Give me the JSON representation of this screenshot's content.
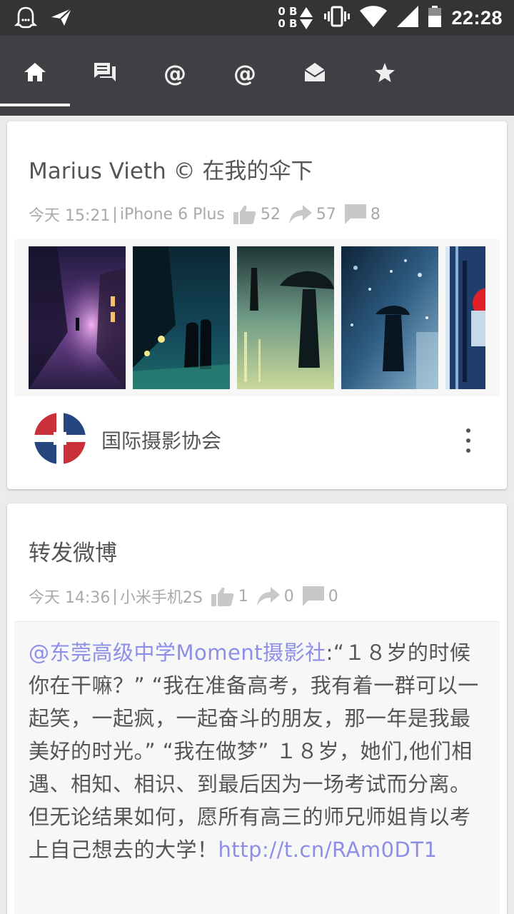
{
  "status_bar": {
    "time": "22:28",
    "net_up": "0 B",
    "net_down": "0 B",
    "icons": [
      "ghost-notification-icon",
      "send-icon",
      "vibrate-icon",
      "wifi-icon",
      "signal-icon",
      "battery-icon"
    ]
  },
  "tabs": [
    {
      "name": "home",
      "icon": "home-icon",
      "active": true
    },
    {
      "name": "comments",
      "icon": "comments-icon"
    },
    {
      "name": "mentions",
      "label": "@"
    },
    {
      "name": "mentions-2",
      "label": "@"
    },
    {
      "name": "messages",
      "icon": "envelope-open-icon"
    },
    {
      "name": "favorites",
      "icon": "star-icon"
    }
  ],
  "posts": [
    {
      "title": "Marius Vieth © 在我的伞下",
      "time": "今天 15:21",
      "separator": "|",
      "device": "iPhone 6 Plus",
      "likes": "52",
      "reposts": "57",
      "comments": "8",
      "source_name": "国际摄影协会"
    },
    {
      "title": "转发微博",
      "time": "今天 14:36",
      "separator": "|",
      "device": "小米手机2S",
      "likes": "1",
      "reposts": "0",
      "comments": "0",
      "retweet": {
        "mention": "@东莞高级中学Moment摄影社",
        "text": ":“１８岁的时候你在干嘛？” “我在准备高考，我有着一群可以一起笑，一起疯，一起奋斗的朋友，那一年是我最美好的时光。” “我在做梦” １８岁，她们,他们相遇、相知、相识、到最后因为一场考试而分离。但无论结果如何，愿所有高三的师兄师姐肯以考上自己想去的大学！",
        "link": "http://t.cn/RAm0DT1"
      }
    }
  ],
  "colors": {
    "status_bar": "#333436",
    "tab_bar": "#3f4043",
    "link": "#8c8ee8",
    "meta_text": "#a9a9a9"
  }
}
